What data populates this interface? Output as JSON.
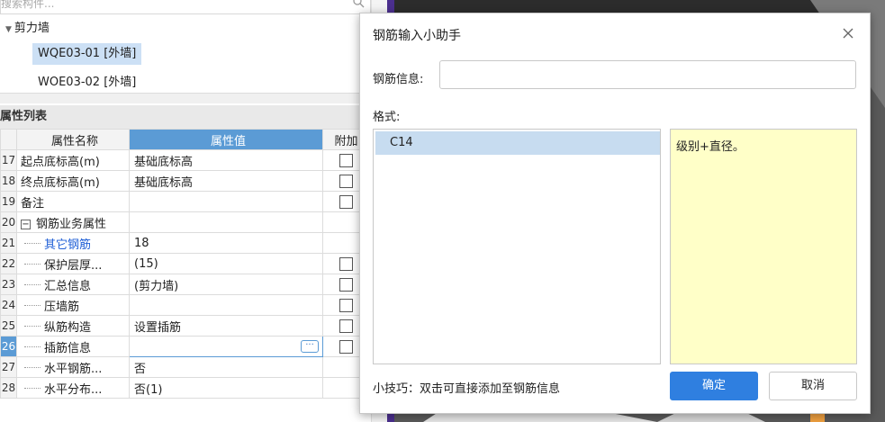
{
  "search": {
    "placeholder": "搜索构件...",
    "icon": "search-icon"
  },
  "tree": {
    "root_label": "剪力墙",
    "items": [
      "WQE03-01 [外墙]",
      "WOE03-02 [外墙]"
    ]
  },
  "properties": {
    "title": "属性列表",
    "headers": {
      "name": "属性名称",
      "value": "属性值",
      "extra": "附加"
    },
    "rows": [
      {
        "num": "17",
        "name": "起点底标高(m)",
        "value": "基础底标高",
        "check": true
      },
      {
        "num": "18",
        "name": "终点底标高(m)",
        "value": "基础底标高",
        "check": true
      },
      {
        "num": "19",
        "name": "备注",
        "value": "",
        "check": true
      },
      {
        "num": "20",
        "name": "钢筋业务属性",
        "value": "",
        "check": false,
        "group": true
      },
      {
        "num": "21",
        "name": "其它钢筋",
        "value": "18",
        "check": false,
        "sub": true,
        "blue": true
      },
      {
        "num": "22",
        "name": "保护层厚...",
        "value": "(15)",
        "check": true,
        "sub": true
      },
      {
        "num": "23",
        "name": "汇总信息",
        "value": "(剪力墙)",
        "check": true,
        "sub": true
      },
      {
        "num": "24",
        "name": "压墙筋",
        "value": "",
        "check": true,
        "sub": true
      },
      {
        "num": "25",
        "name": "纵筋构造",
        "value": "设置插筋",
        "check": true,
        "sub": true
      },
      {
        "num": "26",
        "name": "插筋信息",
        "value": "",
        "check": true,
        "sub": true,
        "active": true
      },
      {
        "num": "27",
        "name": "水平钢筋...",
        "value": "否",
        "check": false,
        "sub": true
      },
      {
        "num": "28",
        "name": "水平分布...",
        "value": "否(1)",
        "check": false,
        "sub": true
      }
    ]
  },
  "dialog": {
    "title": "钢筋输入小助手",
    "info_label": "钢筋信息:",
    "info_value": "",
    "format_label": "格式:",
    "formats": [
      "C14"
    ],
    "hint_text": "级别+直径。",
    "tip": "小技巧：双击可直接添加至钢筋信息",
    "ok_label": "确定",
    "cancel_label": "取消"
  },
  "colors": {
    "accent": "#5b9bd5",
    "ok_button": "#2f7fe0",
    "hint_bg": "#ffffc8",
    "canvas": "#5a5a5a"
  }
}
